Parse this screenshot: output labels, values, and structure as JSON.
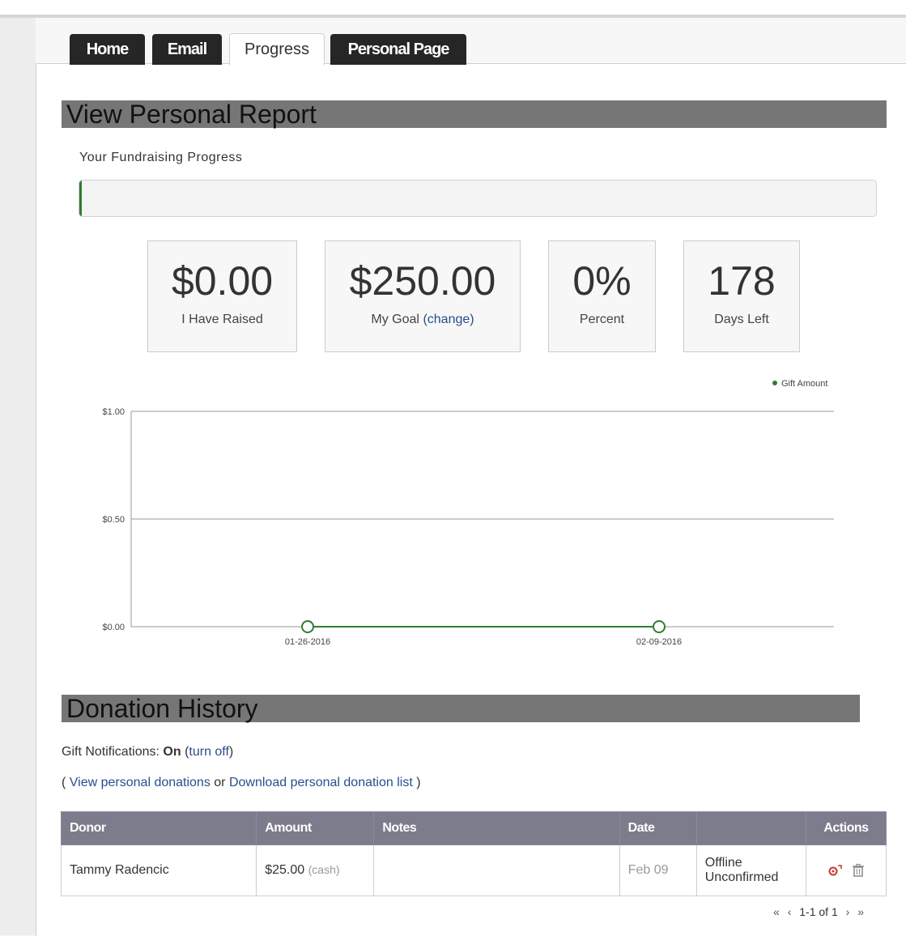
{
  "tabs": [
    {
      "label": "Home"
    },
    {
      "label": "Email"
    },
    {
      "label": "Progress"
    },
    {
      "label": "Personal Page"
    }
  ],
  "report": {
    "title": "View Personal Report",
    "progress_label": "Your Fundraising Progress",
    "progress_fraction": 0
  },
  "stats": {
    "raised": {
      "value": "$0.00",
      "label": "I Have Raised"
    },
    "goal": {
      "value": "$250.00",
      "label": "My Goal",
      "change_link": "(change)"
    },
    "percent": {
      "value": "0%",
      "label": "Percent"
    },
    "days": {
      "value": "178",
      "label": "Days Left"
    }
  },
  "chart_data": {
    "type": "line",
    "x": [
      "01-26-2016",
      "02-09-2016"
    ],
    "series": [
      {
        "name": "Gift Amount",
        "values": [
          0,
          0
        ]
      }
    ],
    "yticks": [
      "$0.00",
      "$0.50",
      "$1.00"
    ],
    "ylim": [
      0,
      1
    ],
    "legend_position": "top-right",
    "grid": true,
    "color": "#2e7d32"
  },
  "donations": {
    "title": "Donation History",
    "notif_prefix": "Gift Notifications:",
    "notif_status": "On",
    "notif_open": "(",
    "notif_link": "turn off",
    "notif_close": ")",
    "links_open": "(",
    "view_link": "View personal donations",
    "links_or": "or",
    "download_link": "Download personal donation list",
    "links_close": ")",
    "columns": [
      "Donor",
      "Amount",
      "Notes",
      "Date",
      "",
      "Actions"
    ],
    "rows": [
      {
        "donor": "Tammy Radencic",
        "amount": "$25.00",
        "method": "(cash)",
        "notes": "",
        "date": "Feb 09",
        "status_line1": "Offline",
        "status_line2": "Unconfirmed"
      }
    ],
    "pager": {
      "first": "«",
      "prev": "‹",
      "range": "1-1 of 1",
      "next": "›",
      "last": "»"
    }
  },
  "colors": {
    "tab_dark": "#262626",
    "section_bar": "#767676",
    "table_header": "#7d7c8c",
    "link": "#2a4d8f",
    "progress": "#2e7d32"
  },
  "icons": [
    "edit-icon",
    "trash-icon"
  ]
}
